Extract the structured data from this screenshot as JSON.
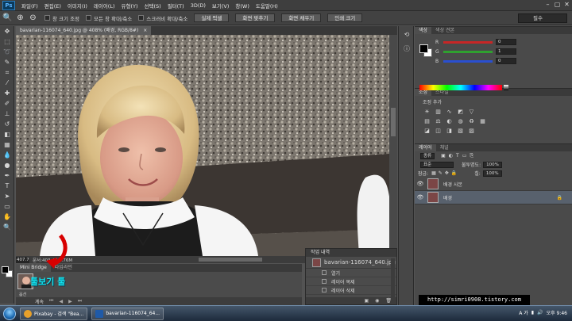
{
  "app": {
    "logo": "Ps"
  },
  "menu": [
    "파일(F)",
    "편집(E)",
    "이미지(I)",
    "레이어(L)",
    "유형(Y)",
    "선택(S)",
    "필터(T)",
    "3D(D)",
    "보기(V)",
    "창(W)",
    "도움말(H)"
  ],
  "window_controls": [
    "–",
    "▢",
    "✕"
  ],
  "options": {
    "check_resize": "창 크기 조정",
    "check_zoom_all": "모든 창 확대/축소",
    "check_scrubby": "스크러비 확대/축소",
    "btn_actual": "실제 픽셀",
    "btn_fit": "화면 맞추기",
    "btn_fill": "화면 채우기",
    "btn_print": "인쇄 크기",
    "workspace": "필수"
  },
  "document": {
    "tab_title": "bavarian-116074_640.jpg @ 408% (배경, RGB/8#)",
    "close": "×",
    "zoom": "407.79%",
    "doc_size": "문서:403.4K/1.76M"
  },
  "bottom": {
    "tab_bridge": "Mini Bridge",
    "tab_timeline": "타임라인",
    "annotation": "툴보기 툴",
    "thumb_label": "옵션",
    "footer_label": "계속"
  },
  "history": {
    "title": "작업 내역",
    "snapshot": "bavarian-116074_640.jpg",
    "items": [
      "열기",
      "레이어 복제",
      "레이어 삭제"
    ]
  },
  "color_panel": {
    "tabs": [
      "색상",
      "색상 견본"
    ],
    "sliders": [
      {
        "label": "R",
        "value": "0",
        "color": "#c72626"
      },
      {
        "label": "G",
        "value": "1",
        "color": "#2fa02f"
      },
      {
        "label": "B",
        "value": "0",
        "color": "#2a4fd0"
      }
    ]
  },
  "adjust_panel": {
    "tabs": [
      "조정",
      "스타일"
    ],
    "add_label": "조정 추가"
  },
  "layers_panel": {
    "tabs": [
      "레이어",
      "채널"
    ],
    "kind": "종류",
    "blend_mode": "표준",
    "opacity_label": "불투명도:",
    "opacity_value": "100%",
    "lock_label": "잠금:",
    "fill_label": "칠:",
    "fill_value": "100%",
    "layers": [
      {
        "name": "배경 사본",
        "selected": false
      },
      {
        "name": "배경",
        "selected": true
      }
    ]
  },
  "watermark": "http://simri0908.tistory.com",
  "taskbar": {
    "tasks": [
      {
        "label": "Pixabay - 검색 \"Bea...",
        "color": "#e7a02a"
      },
      {
        "label": "bavarian-116074_64...",
        "color": "#1f5aa8"
      }
    ],
    "tray_lang": "A 가",
    "clock": "오후 9:46"
  }
}
